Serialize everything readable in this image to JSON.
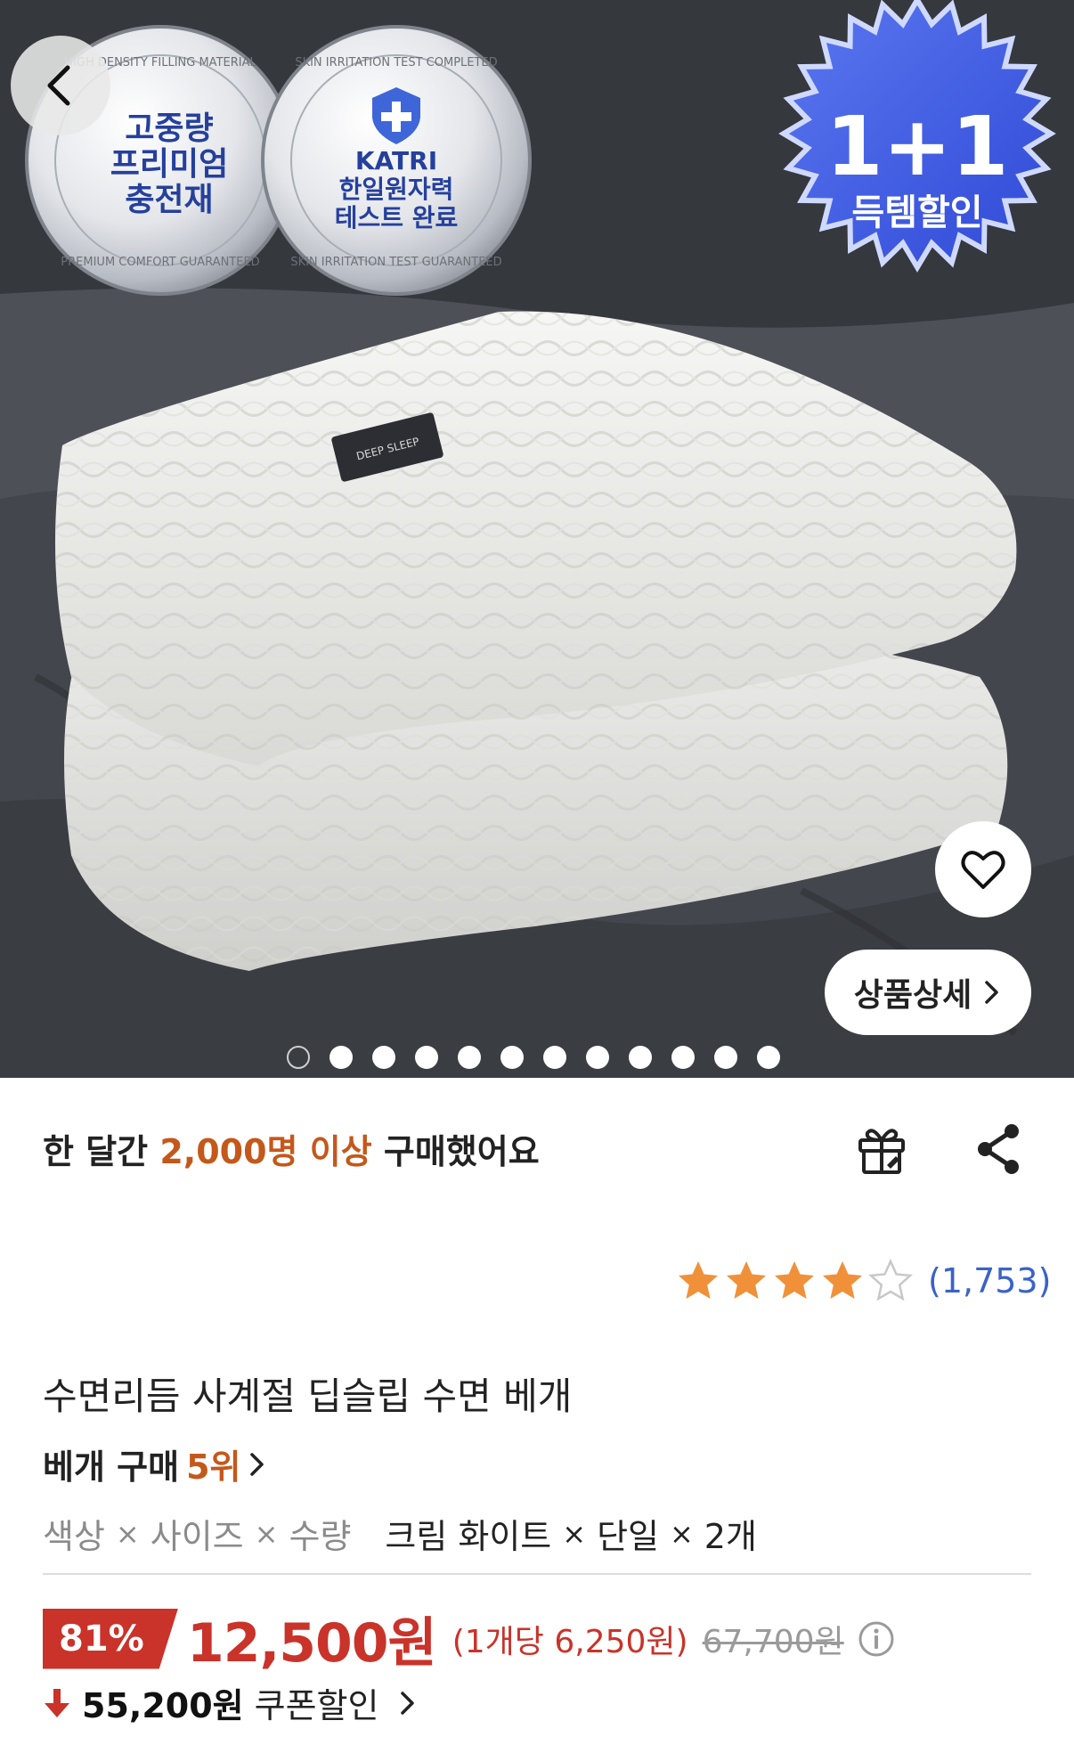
{
  "hero": {
    "badge1": {
      "arc_top": "HIGH DENSITY FILLING MATERIAL",
      "arc_bottom": "PREMIUM COMFORT GUARANTEED",
      "lines": [
        "고중량",
        "프리미엄",
        "충전재"
      ]
    },
    "badge2": {
      "arc_top": "SKIN IRRITATION TEST COMPLETED",
      "arc_bottom": "SKIN IRRITATION TEST GUARANTEED",
      "lines": [
        "KATRI",
        "한일원자력",
        "테스트 완료"
      ]
    },
    "promo": {
      "big": "1+1",
      "small": "득템할인"
    },
    "pillow_tag": "DEEP SLEEP",
    "detail_label": "상품상세",
    "carousel": {
      "count": 12,
      "active_index": 0
    }
  },
  "social": {
    "prefix": "한 달간",
    "highlight": "2,000명 이상",
    "suffix": "구매했어요"
  },
  "rating": {
    "value": 4,
    "max": 5,
    "count": "(1,753)"
  },
  "product": {
    "title": "수면리듬 사계절 딥슬립 수면 베개",
    "rank_label": "베개 구매",
    "rank_value": "5위"
  },
  "options": {
    "labels": [
      "색상",
      "사이즈",
      "수량"
    ],
    "values": [
      "크림 화이트",
      "단일",
      "2개"
    ],
    "sep": "×"
  },
  "price": {
    "discount": "81%",
    "sale": "12,500원",
    "unit": "(1개당 6,250원)",
    "original": "67,700원"
  },
  "coupon": {
    "price": "55,200원",
    "label": "쿠폰할인"
  },
  "colors": {
    "accent_orange": "#c4581b",
    "price_red": "#c9332a",
    "review_blue": "#3a62c9",
    "star": "#f0913a"
  }
}
